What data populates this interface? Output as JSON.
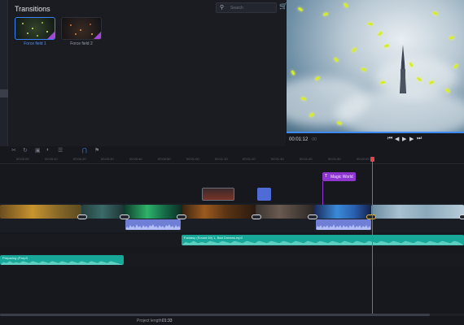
{
  "transitions_panel": {
    "title": "Transitions",
    "search": {
      "placeholder": "Search",
      "icon": "search-icon"
    },
    "cart_icon": "cart-icon",
    "items": [
      {
        "label": "Force field 1",
        "selected": true
      },
      {
        "label": "Force field 2",
        "selected": false
      }
    ]
  },
  "player": {
    "timecode": "00:01:12",
    "timecode_fraction": ":00",
    "progress": 1.0,
    "controls": [
      "skip-start-icon",
      "prev-frame-icon",
      "play-icon",
      "next-frame-icon",
      "skip-end-icon"
    ]
  },
  "toolbar": {
    "tools": [
      "cut-icon",
      "rotate-icon",
      "crop-icon",
      "color-icon",
      "list-icon",
      "magnet-icon",
      "flag-icon"
    ]
  },
  "ruler": {
    "ticks": [
      "00:00:00",
      "00:00:10",
      "00:00:20",
      "00:00:30",
      "00:00:40",
      "00:00:50",
      "00:01:00",
      "00:01:10",
      "00:01:20",
      "00:01:30",
      "00:01:40",
      "00:01:50",
      "00:02:00"
    ]
  },
  "timeline": {
    "title_clip": {
      "label": "Magic World",
      "icon": "title-icon"
    },
    "audio_tracks": [
      {
        "label": "Fantasy (Sound 60) 1, Bad Dreams.mp3"
      },
      {
        "label": "Preparing (P.mp3"
      }
    ]
  },
  "status": {
    "project_length_label": "Project length:",
    "project_length_value": "01:33"
  },
  "colors": {
    "accent": "#3b82f6",
    "playhead": "#e0474d",
    "title_clip": "#9036d0",
    "audio": "#17a89a",
    "audio_linked": "#6f7fd6",
    "effect_clip": "#4f6bd8"
  }
}
